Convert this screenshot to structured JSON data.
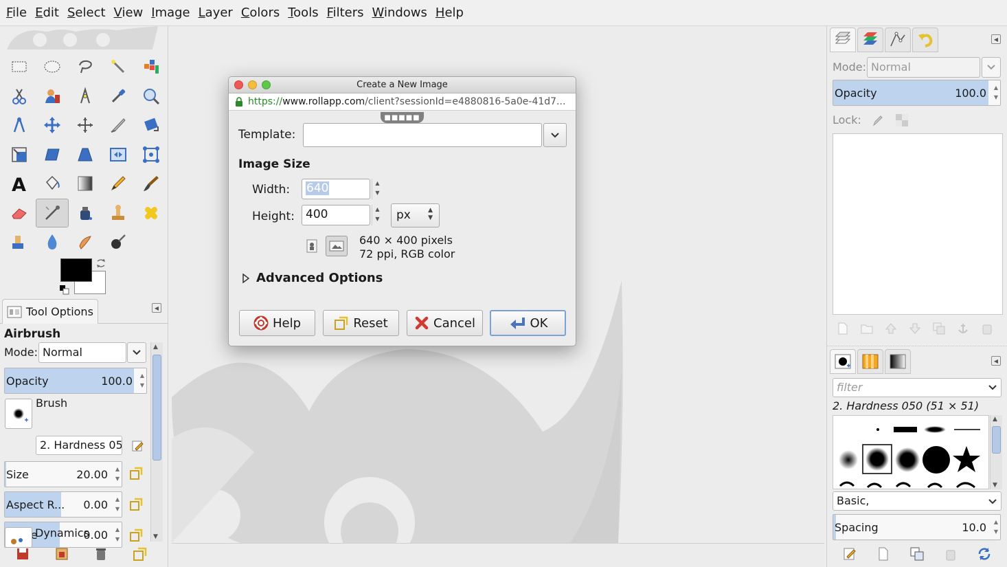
{
  "menu": [
    "File",
    "Edit",
    "Select",
    "View",
    "Image",
    "Layer",
    "Colors",
    "Tools",
    "Filters",
    "Windows",
    "Help"
  ],
  "tool_options": {
    "tab_label": "Tool Options",
    "tool_name": "Airbrush",
    "mode_label": "Mode:",
    "mode_value": "Normal",
    "opacity_label": "Opacity",
    "opacity_value": "100.0",
    "brush_label": "Brush",
    "brush_value": "2. Hardness 050",
    "size_label": "Size",
    "size_value": "20.00",
    "aspect_label": "Aspect R...",
    "aspect_value": "0.00",
    "angle_label": "Angle",
    "angle_value": "0.00",
    "dynamics_label": "Dynamics"
  },
  "layers": {
    "mode_label": "Mode:",
    "mode_value": "Normal",
    "opacity_label": "Opacity",
    "opacity_value": "100.0",
    "lock_label": "Lock:"
  },
  "brushes": {
    "filter_placeholder": "filter",
    "selected_brush": "2. Hardness 050 (51 × 51)",
    "preset": "Basic,",
    "spacing_label": "Spacing",
    "spacing_value": "10.0"
  },
  "dialog": {
    "title": "Create a New Image",
    "url_scheme": "https://",
    "url_host": "www.rollapp.com",
    "url_rest": "/client?sessionId=e4880816-5a0e-41d7...",
    "template_label": "Template:",
    "template_value": "",
    "image_size_heading": "Image Size",
    "width_label": "Width:",
    "width_value": "640",
    "height_label": "Height:",
    "height_value": "400",
    "unit": "px",
    "info_line1": "640 × 400 pixels",
    "info_line2": "72 ppi, RGB color",
    "advanced_label": "Advanced Options",
    "help_label": "Help",
    "reset_label": "Reset",
    "cancel_label": "Cancel",
    "ok_label": "OK"
  },
  "colors": {
    "foreground": "#000000",
    "background": "#ffffff",
    "accent": "#bdd3ee"
  }
}
